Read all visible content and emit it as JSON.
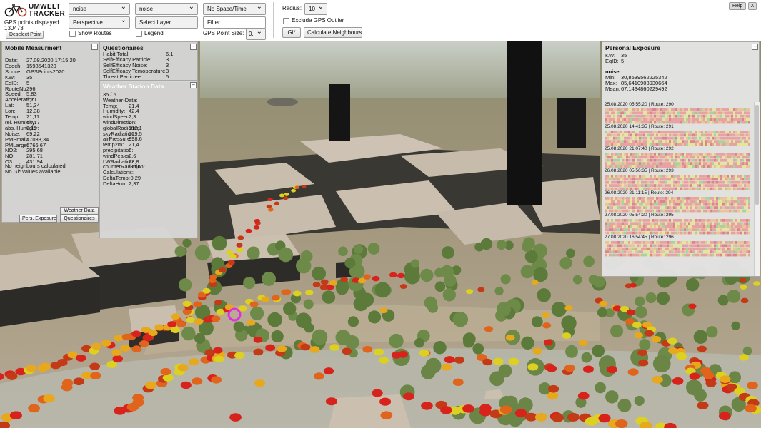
{
  "app": {
    "logo_line1": "UMWELT",
    "logo_line2": "TRACKER",
    "gps_points_label": "GPS points displayed",
    "gps_points_count": "130473",
    "deselect_label": "Deselect Point"
  },
  "toolbar": {
    "dataset_value": "noise",
    "dataset2_value": "noise",
    "space_time_value": "No Space/Time",
    "camera_value": "Perspective",
    "layer_value": "Select Layer",
    "filter_value": "Filter",
    "show_routes_label": "Show Routes",
    "legend_label": "Legend",
    "gps_point_size_label": "GPS Point Size:",
    "gps_point_size_value": "0,",
    "radius_label": "Radius:",
    "radius_value": "10",
    "exclude_outlier_label": "Exclude GPS Outlier",
    "gi_label": "Gi*",
    "calc_neighbours_label": "Calculate Neighbours",
    "help_label": "Help",
    "close_label": "X"
  },
  "mobile": {
    "title": "Mobile Measurment",
    "rows": [
      {
        "k": "Date:",
        "v": "27.08.2020 17:15:20"
      },
      {
        "k": "Epoch:",
        "v": "1598541320"
      },
      {
        "k": "Souce:",
        "v": "GPSPoints2020"
      },
      {
        "k": "KW:",
        "v": "35"
      },
      {
        "k": "EqID:",
        "v": "5"
      },
      {
        "k": "RouteNb:",
        "v": "296"
      },
      {
        "k": "Speed:",
        "v": "5,83"
      },
      {
        "k": "Acceleration:",
        "v": "5,77"
      },
      {
        "k": "Lat:",
        "v": "51,34"
      },
      {
        "k": "Lon:",
        "v": "12,38"
      },
      {
        "k": "Temp:",
        "v": "21,11"
      },
      {
        "k": "rel. Humidity:",
        "v": "44,77"
      },
      {
        "k": "abs. Humidity:",
        "v": "8,19"
      },
      {
        "k": "Noise:",
        "v": "69,22"
      },
      {
        "k": "PMSmall:",
        "v": "47033,34"
      },
      {
        "k": "PMLarge:",
        "v": "6766,67"
      },
      {
        "k": "NO2:",
        "v": "295,68"
      },
      {
        "k": "NO:",
        "v": "281,71"
      },
      {
        "k": "O3:",
        "v": "431,94"
      }
    ],
    "note1": "No neighbours calculated",
    "note2": "No Gi* values available",
    "btn_weather": "Weather Data",
    "btn_exposure": "Pers. Exposure",
    "btn_questionaires": "Questionaires"
  },
  "questionaires": {
    "title": "Questionaires",
    "rows": [
      {
        "k": "Habit Total:",
        "v": "6,1"
      },
      {
        "k": "SelfEfficacy Particle:",
        "v": "3"
      },
      {
        "k": "SelfEfficacy Noise:",
        "v": "3"
      },
      {
        "k": "SelfEfficacy Temoperature:",
        "v": "3"
      },
      {
        "k": "Threat Particlee:",
        "v": "5"
      }
    ]
  },
  "weather": {
    "title": "Weather Station Data",
    "rows": [
      {
        "k": "35 / 5",
        "v": ""
      },
      {
        "k": "Weather-Data:",
        "v": ""
      },
      {
        "k": "Temp:",
        "v": "21,4"
      },
      {
        "k": "Humidity:",
        "v": "42,4"
      },
      {
        "k": "windSpeed:",
        "v": "2,3"
      },
      {
        "k": "windDirection:",
        "v": "0"
      },
      {
        "k": "globalRadiation:",
        "v": "312,1"
      },
      {
        "k": "skyRadiation:",
        "v": "109,5"
      },
      {
        "k": "airPressure:",
        "v": "998,6"
      },
      {
        "k": "temp2m:",
        "v": "21,4"
      },
      {
        "k": "precipitation:",
        "v": "0"
      },
      {
        "k": "windPeaks:",
        "v": "2,6"
      },
      {
        "k": "LWRadiation:",
        "v": "23,8"
      },
      {
        "k": "counterRadiation:",
        "v": "-86,6"
      },
      {
        "k": "Calculations:",
        "v": ""
      },
      {
        "k": "DeltaTemp:",
        "v": "-0,29"
      },
      {
        "k": "DeltaHum:",
        "v": "2,37"
      }
    ]
  },
  "exposure": {
    "title": "Personal Exposure",
    "kw_label": "KW:",
    "kw_value": "35",
    "eqid_label": "EqID:",
    "eqid_value": "5",
    "metric": "noise",
    "min_label": "Min:",
    "min_value": "30,8539562225342",
    "max_label": "Max:",
    "max_value": "85,6410903930664",
    "mean_label": "Mean:",
    "mean_value": "67,1434860229492",
    "routes": [
      {
        "label": "25.08.2020 05:55:20 | Route: 290"
      },
      {
        "label": "25.08.2020 14:41:35 | Route: 291"
      },
      {
        "label": "25.08.2020 21:07:40 | Route: 292"
      },
      {
        "label": "26.08.2020 05:56:35 | Route: 293"
      },
      {
        "label": "26.08.2020 21:11:15 | Route: 294"
      },
      {
        "label": "27.08.2020 05:54:20 | Route: 295"
      },
      {
        "label": "27.08.2020 16:54:45 | Route: 296"
      }
    ],
    "strip_colors": [
      "#e7a3a3",
      "#e9c39a",
      "#e4e79b",
      "#a9d2a1",
      "#d9868c"
    ]
  },
  "colors": {
    "accent": "#e02ee0",
    "panel_bg": "#d7d7d7",
    "ground": "#8c8a6f"
  }
}
